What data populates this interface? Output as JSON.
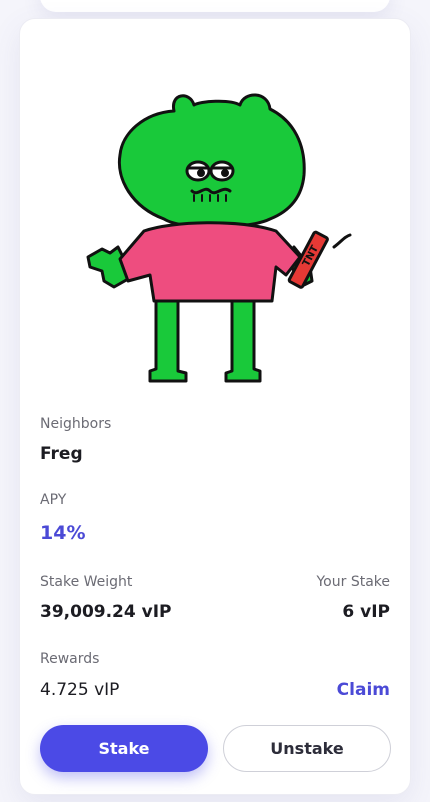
{
  "nft": {
    "collection_label": "Neighbors",
    "name": "Freg",
    "tnt_label": "TNT"
  },
  "apy": {
    "label": "APY",
    "value": "14%"
  },
  "stake_weight": {
    "label": "Stake Weight",
    "value": "39,009.24 vIP"
  },
  "your_stake": {
    "label": "Your Stake",
    "value": "6 vIP"
  },
  "rewards": {
    "label": "Rewards",
    "value": "4.725 vIP",
    "claim_label": "Claim"
  },
  "actions": {
    "stake_label": "Stake",
    "unstake_label": "Unstake"
  },
  "colors": {
    "accent": "#4b4ae6",
    "frog_green": "#19c93a",
    "shirt_pink": "#ee4d7f",
    "dynamite_red": "#e53935"
  }
}
